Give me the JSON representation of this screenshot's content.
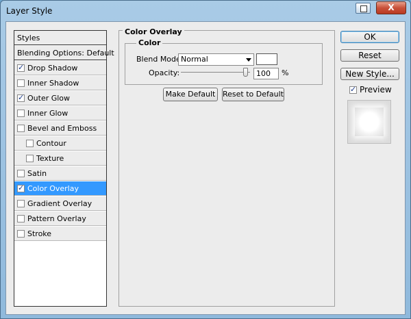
{
  "window": {
    "title": "Layer Style",
    "close_label": "X"
  },
  "styles_list": {
    "header": "Styles",
    "blending_options": "Blending Options: Default",
    "items": [
      {
        "label": "Drop Shadow",
        "checked": true
      },
      {
        "label": "Inner Shadow",
        "checked": false
      },
      {
        "label": "Outer Glow",
        "checked": true
      },
      {
        "label": "Inner Glow",
        "checked": false
      },
      {
        "label": "Bevel and Emboss",
        "checked": false
      },
      {
        "label": "Contour",
        "checked": false
      },
      {
        "label": "Texture",
        "checked": false
      },
      {
        "label": "Satin",
        "checked": false
      },
      {
        "label": "Color Overlay",
        "checked": true
      },
      {
        "label": "Gradient Overlay",
        "checked": false
      },
      {
        "label": "Pattern Overlay",
        "checked": false
      },
      {
        "label": "Stroke",
        "checked": false
      }
    ]
  },
  "color_overlay": {
    "title": "Color Overlay",
    "group_title": "Color",
    "blend_mode_label": "Blend Mode:",
    "blend_mode_value": "Normal",
    "swatch_color": "#ffffff",
    "opacity_label": "Opacity:",
    "opacity_value": "100",
    "opacity_unit": "%",
    "make_default_label": "Make Default",
    "reset_default_label": "Reset to Default"
  },
  "actions": {
    "ok_label": "OK",
    "reset_label": "Reset",
    "new_style_label": "New Style...",
    "preview_label": "Preview",
    "preview_checked": true
  },
  "colors": {
    "selection": "#3399ff",
    "dialog_bg": "#ececec",
    "title_bar": "#a9cbe6"
  }
}
